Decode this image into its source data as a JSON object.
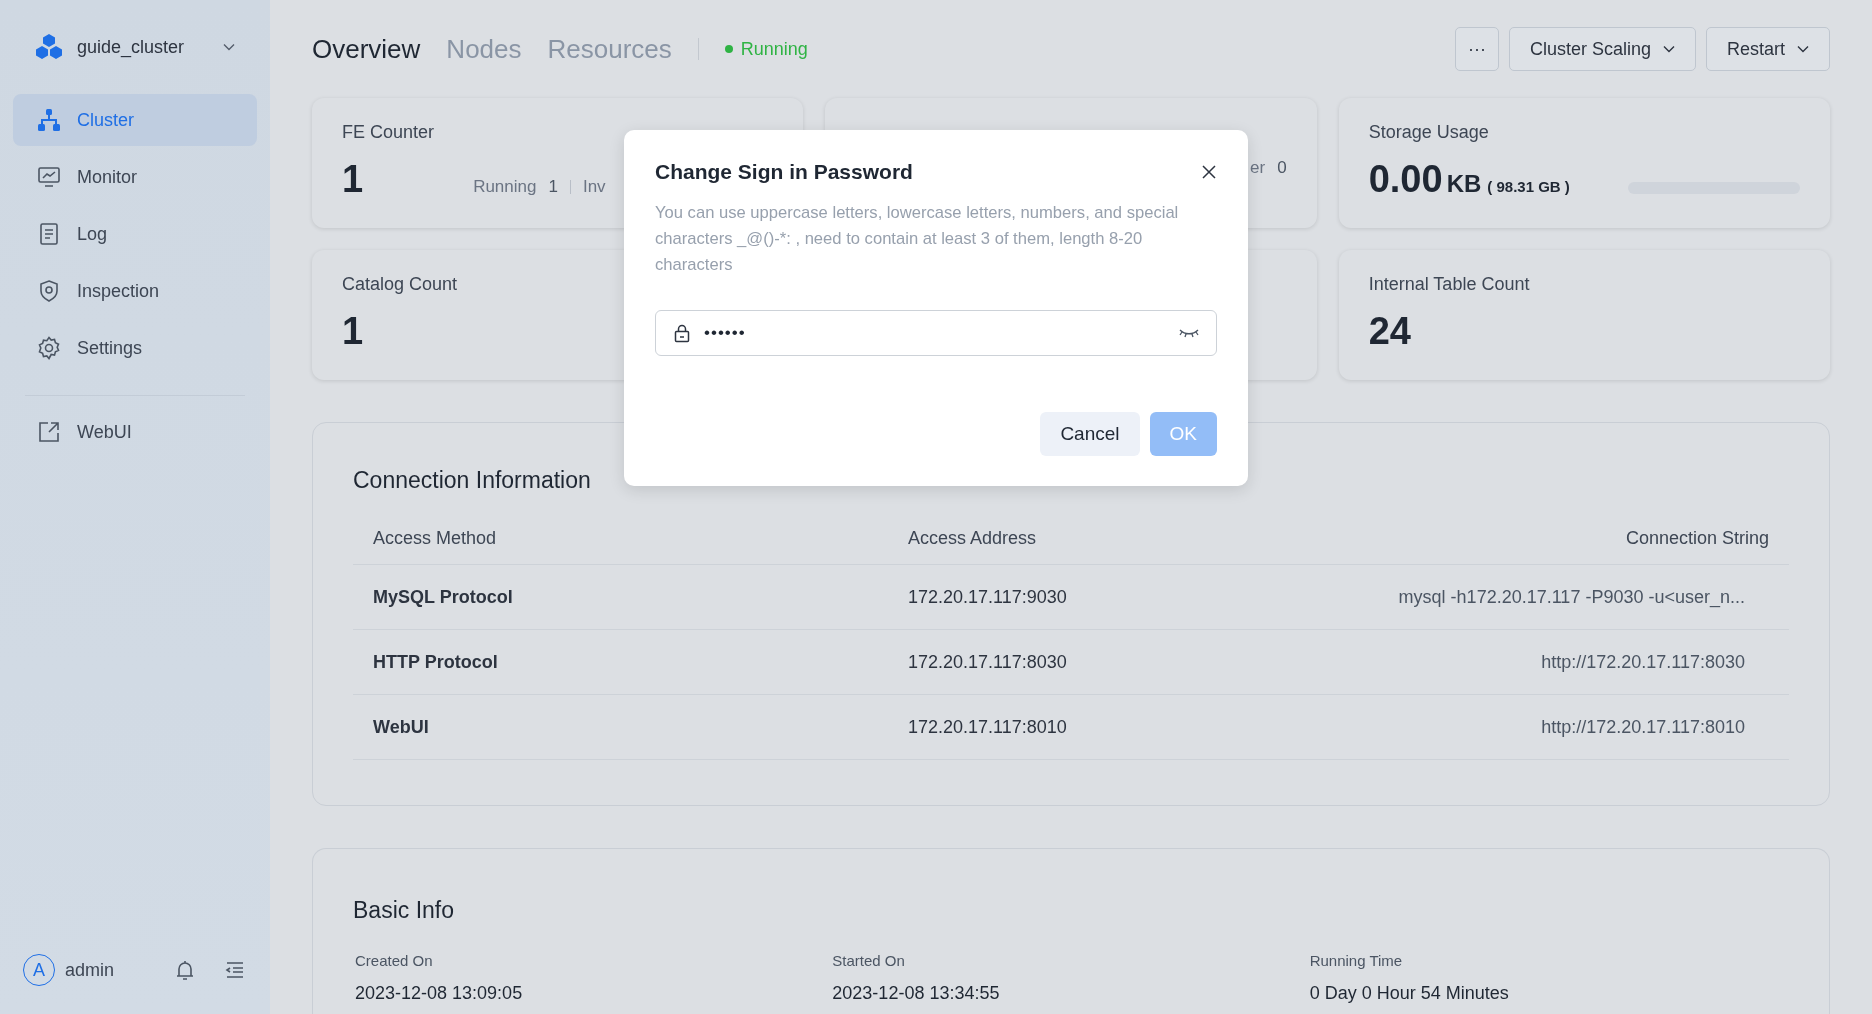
{
  "sidebar": {
    "cluster_name": "guide_cluster",
    "items": [
      {
        "label": "Cluster",
        "kind": "cluster",
        "selected": true
      },
      {
        "label": "Monitor",
        "kind": "monitor",
        "selected": false
      },
      {
        "label": "Log",
        "kind": "log",
        "selected": false
      },
      {
        "label": "Inspection",
        "kind": "inspection",
        "selected": false
      },
      {
        "label": "Settings",
        "kind": "settings",
        "selected": false
      }
    ],
    "external": {
      "label": "WebUI"
    },
    "user": {
      "avatar": "A",
      "name": "admin"
    }
  },
  "tabs": [
    {
      "label": "Overview",
      "selected": true
    },
    {
      "label": "Nodes",
      "selected": false
    },
    {
      "label": "Resources",
      "selected": false
    }
  ],
  "status": {
    "label": "Running"
  },
  "actions": [
    {
      "label": "···",
      "kind": "more"
    },
    {
      "label": "Cluster Scaling",
      "kind": "dropdown"
    },
    {
      "label": "Restart",
      "kind": "dropdown"
    }
  ],
  "cards": [
    {
      "kind": "counter",
      "title": "FE Counter",
      "value": "1",
      "stats": [
        {
          "label": "Running",
          "value": "1"
        },
        {
          "label": "Inv"
        }
      ]
    },
    {
      "kind": "counter_hidden",
      "stats": [
        {
          "label": "er",
          "value": "0"
        }
      ]
    },
    {
      "kind": "storage",
      "title": "Storage Usage",
      "value": "0.00",
      "unit": "KB",
      "total": "( 98.31 GB )",
      "level": 0
    },
    {
      "kind": "counter",
      "title": "Catalog Count",
      "value": "1"
    },
    {
      "kind": "counter_hidden"
    },
    {
      "kind": "counter",
      "title": "Internal Table Count",
      "value": "24"
    }
  ],
  "connection": {
    "title": "Connection Information",
    "columns": [
      "Access Method",
      "Access Address",
      "Connection String"
    ],
    "rows": [
      [
        "MySQL Protocol",
        "172.20.17.117:9030",
        "mysql -h172.20.17.117 -P9030 -u<user_n..."
      ],
      [
        "HTTP Protocol",
        "172.20.17.117:8030",
        "http://172.20.17.117:8030"
      ],
      [
        "WebUI",
        "172.20.17.117:8010",
        "http://172.20.17.117:8010"
      ]
    ]
  },
  "basic_info": {
    "title": "Basic Info",
    "fields": [
      {
        "label": "Created On",
        "value": "2023-12-08 13:09:05"
      },
      {
        "label": "Started On",
        "value": "2023-12-08 13:34:55"
      },
      {
        "label": "Running Time",
        "value": "0 Day 0 Hour 54 Minutes"
      }
    ]
  },
  "dialog": {
    "title": "Change Sign in Password",
    "description": "You can use uppercase letters, lowercase letters, numbers, and special characters _@()-*: , need to contain at least 3 of them, length 8-20 characters",
    "password": {
      "value": "••••••"
    },
    "buttons": [
      {
        "label": "Cancel",
        "kind": "secondary",
        "disabled": false
      },
      {
        "label": "OK",
        "kind": "primary",
        "disabled": true
      }
    ]
  }
}
